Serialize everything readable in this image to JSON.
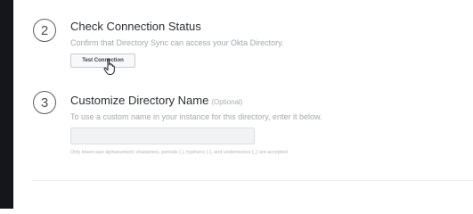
{
  "steps": [
    {
      "number": "2",
      "title": "Check Connection Status",
      "description": "Confirm that Directory Sync can access your Okta Directory.",
      "button_label": "Test Connection"
    },
    {
      "number": "3",
      "title": "Customize Directory Name",
      "optional_label": "(Optional)",
      "description": "To use a custom name in your instance for this directory, enter it below.",
      "input_value": "",
      "help_text": "Only lowercase alphanumeric characters, periods (.), hyphens (-), and underscores (_) are accepted."
    }
  ],
  "cursor_icon": "hand-pointer-icon",
  "colors": {
    "sidebar": "#14161b",
    "title": "#2b2f36",
    "muted_text": "#a4a8b0",
    "input_background": "#f2f3f5"
  }
}
